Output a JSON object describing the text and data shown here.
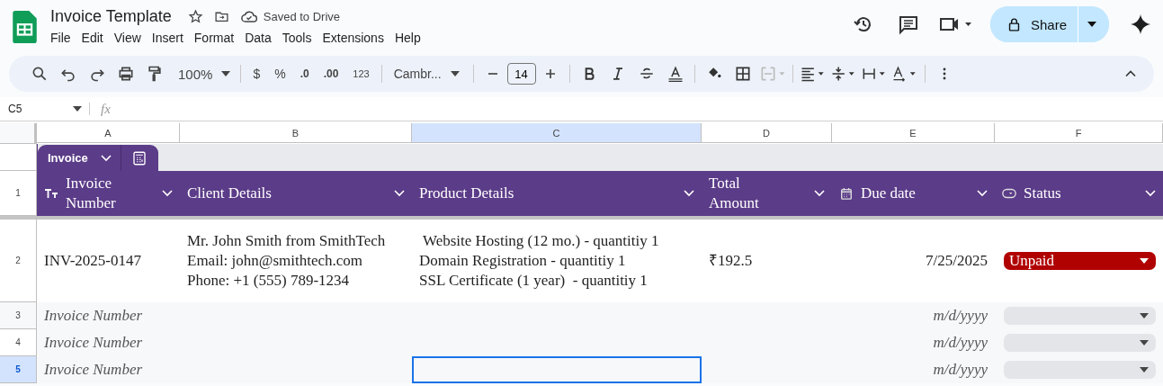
{
  "document": {
    "title": "Invoice Template",
    "save_status": "Saved to Drive"
  },
  "menu": [
    "File",
    "Edit",
    "View",
    "Insert",
    "Format",
    "Data",
    "Tools",
    "Extensions",
    "Help"
  ],
  "share_button": {
    "label": "Share"
  },
  "toolbar": {
    "zoom": "100%",
    "currency": "$",
    "percent": "%",
    "decrease_decimals": ".0",
    "increase_decimals": ".00",
    "number_format": "123",
    "font": "Cambr...",
    "font_size": "14"
  },
  "formula_bar": {
    "cell": "C5",
    "fx": "fx"
  },
  "columns": [
    {
      "letter": "A",
      "selected": false
    },
    {
      "letter": "B",
      "selected": false
    },
    {
      "letter": "C",
      "selected": true
    },
    {
      "letter": "D",
      "selected": false
    },
    {
      "letter": "E",
      "selected": false
    },
    {
      "letter": "F",
      "selected": false
    }
  ],
  "table": {
    "name": "Invoice",
    "header_row_number": "1",
    "headers": [
      {
        "label": "Invoice Number",
        "kind": "text"
      },
      {
        "label": "Client Details",
        "kind": "plain"
      },
      {
        "label": "Product Details",
        "kind": "plain"
      },
      {
        "label": "Total Amount",
        "kind": "plain"
      },
      {
        "label": "Due date",
        "kind": "date"
      },
      {
        "label": "Status",
        "kind": "dropdown"
      }
    ],
    "rows": [
      {
        "number": "2",
        "selected": false,
        "hint": false,
        "invoice_number": "INV-2025-0147",
        "client_details": "Mr. John Smith from SmithTech\nEmail: john@smithtech.com\nPhone: +1 (555) 789-1234",
        "product_details": " Website Hosting (12 mo.) - quantitiy 1\nDomain Registration - quantitiy 1\nSSL Certificate (1 year)  - quantitiy 1",
        "total_amount": "₹192.5",
        "due_date": "7/25/2025",
        "status": {
          "label": "Unpaid",
          "color": "#b10202"
        }
      },
      {
        "number": "3",
        "selected": false,
        "hint": true,
        "invoice_number": "Invoice Number",
        "due_date": "m/d/yyyy"
      },
      {
        "number": "4",
        "selected": false,
        "hint": true,
        "invoice_number": "Invoice Number",
        "due_date": "m/d/yyyy"
      },
      {
        "number": "5",
        "selected": true,
        "hint": true,
        "invoice_number": "Invoice Number",
        "due_date": "m/d/yyyy"
      }
    ]
  }
}
